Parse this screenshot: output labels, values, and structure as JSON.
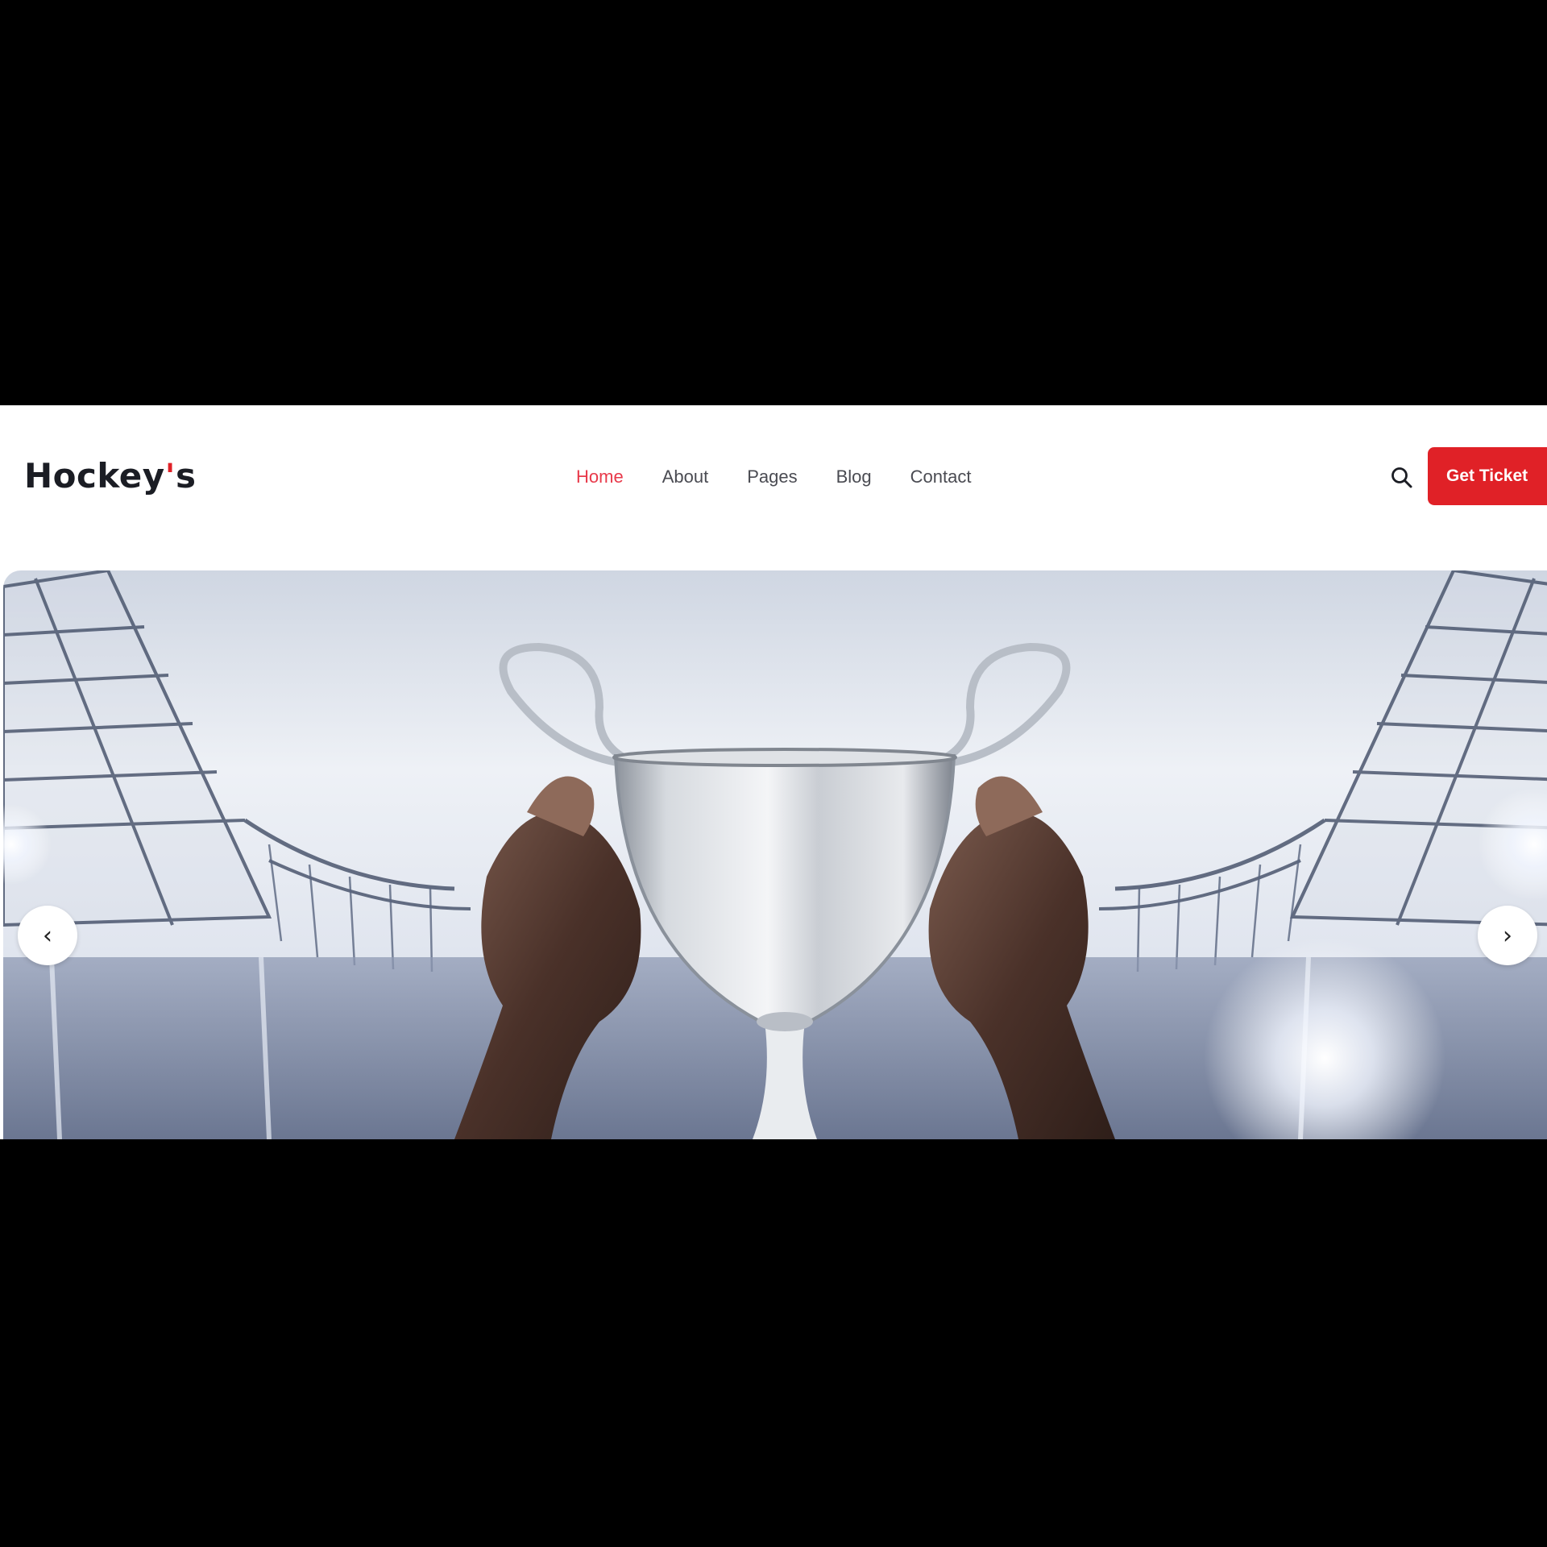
{
  "header": {
    "logo_main": "Hockey",
    "logo_apostrophe": "'",
    "logo_suffix": "s",
    "nav": [
      {
        "label": "Home",
        "active": true
      },
      {
        "label": "About",
        "active": false
      },
      {
        "label": "Pages",
        "active": false
      },
      {
        "label": "Blog",
        "active": false
      },
      {
        "label": "Contact",
        "active": false
      }
    ],
    "search_icon": "search-icon",
    "cta_label": "Get Ticket"
  },
  "hero": {
    "image_subject": "hands-holding-silver-trophy-in-stadium",
    "prev_icon": "chevron-left-icon",
    "prev_glyph": "‹",
    "next_icon": "chevron-right-icon",
    "next_glyph": "›"
  },
  "colors": {
    "accent": "#e02127",
    "active_nav": "#e8394a",
    "text_dark": "#1b1d24",
    "nav_text": "#4a4b52",
    "page_bg": "#000000"
  }
}
